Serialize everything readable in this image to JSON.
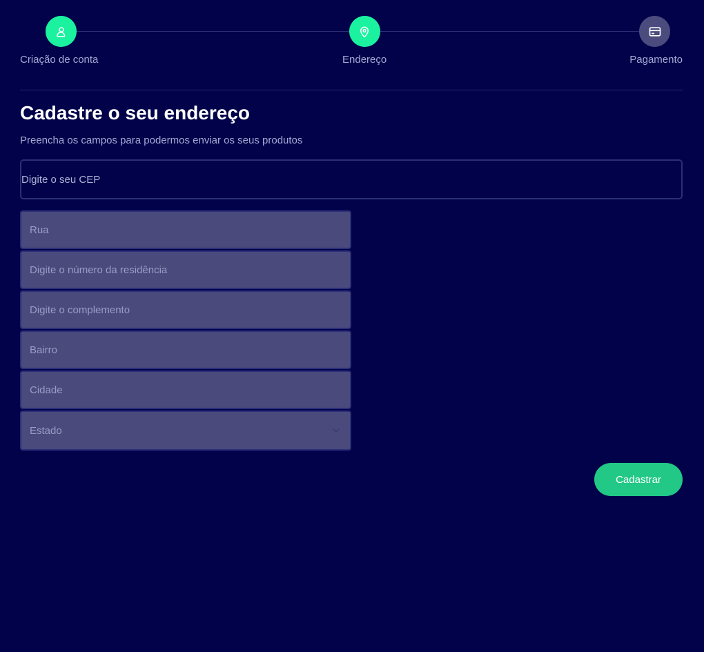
{
  "stepper": {
    "steps": [
      {
        "label": "Criação de conta",
        "icon": "user-icon",
        "state": "active"
      },
      {
        "label": "Endereço",
        "icon": "map-pin-icon",
        "state": "active"
      },
      {
        "label": "Pagamento",
        "icon": "credit-card-icon",
        "state": "inactive"
      }
    ]
  },
  "form": {
    "title": "Cadastre o seu endereço",
    "subtitle": "Preencha os campos para podermos enviar os seus produtos",
    "cep_placeholder": "Digite o seu CEP",
    "rua_placeholder": "Rua",
    "numero_placeholder": "Digite o número da residência",
    "complemento_placeholder": "Digite o complemento",
    "bairro_placeholder": "Bairro",
    "cidade_placeholder": "Cidade",
    "estado_selected": "Estado",
    "submit_label": "Cadastrar"
  },
  "colors": {
    "background": "#02024a",
    "accent": "#1af2a0",
    "button": "#21c886",
    "inactive_step": "#4b4b7e",
    "field_bg": "#4a4a7c"
  }
}
